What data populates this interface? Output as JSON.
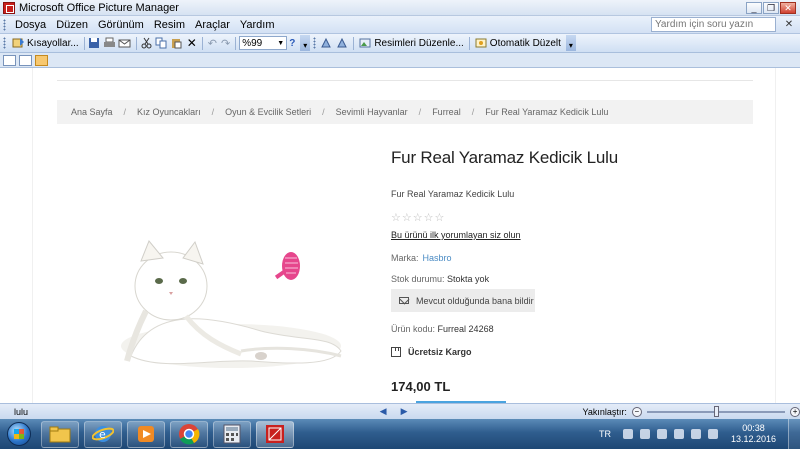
{
  "window": {
    "title": "Microsoft Office Picture Manager",
    "minimize": "_",
    "restore": "❐",
    "close": "✕"
  },
  "menu": {
    "items": [
      "Dosya",
      "Düzen",
      "Görünüm",
      "Resim",
      "Araçlar",
      "Yardım"
    ],
    "help_placeholder": "Yardım için soru yazın",
    "help_close": "✕"
  },
  "toolbar": {
    "shortcuts_label": "Kısayollar...",
    "zoom_value": "%99",
    "edit_pictures_label": "Resimleri Düzenle...",
    "auto_correct_label": "Otomatik Düzelt"
  },
  "webpage": {
    "breadcrumb": [
      "Ana Sayfa",
      "Kız Oyuncakları",
      "Oyun & Evcilik Setleri",
      "Sevimli Hayvanlar",
      "Furreal",
      "Fur Real Yaramaz Kedicik Lulu"
    ],
    "breadcrumb_sep": "/",
    "title": "Fur Real Yaramaz Kedicik Lulu",
    "subtitle": "Fur Real Yaramaz Kedicik Lulu",
    "rating_stars": "☆☆☆☆☆",
    "review_link": "Bu ürünü ilk yorumlayan siz olun",
    "brand_label": "Marka:",
    "brand_value": "Hasbro",
    "stock_label": "Stok durumu:",
    "stock_value": "Stokta yok",
    "notify_button": "Mevcut olduğunda bana bildir",
    "code_label": "Ürün kodu:",
    "code_value": "Furreal 24268",
    "shipping": "Ücretsiz Kargo",
    "price": "174,00 TL"
  },
  "status": {
    "file_name": "lulu",
    "prev": "◀",
    "next": "▶",
    "zoom_label": "Yakınlaştır:",
    "zoom_minus": "−",
    "zoom_plus": "+",
    "zoom_fraction": 0.5
  },
  "taskbar": {
    "lang": "TR",
    "time": "00:38",
    "date": "13.12.2016"
  }
}
